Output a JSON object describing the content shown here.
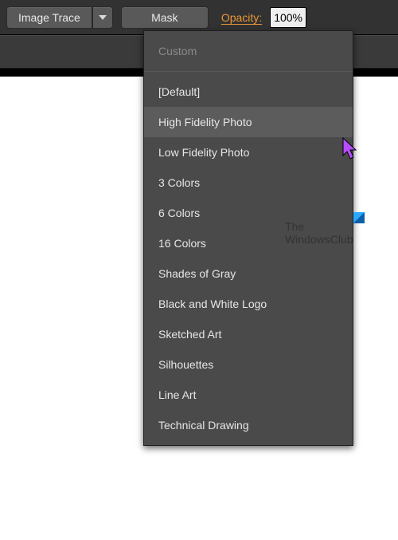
{
  "toolbar": {
    "image_trace_label": "Image Trace",
    "mask_label": "Mask",
    "opacity_label": "Opacity:",
    "opacity_value": "100%"
  },
  "dropdown": {
    "header_disabled": "Custom",
    "items": [
      "[Default]",
      "High Fidelity Photo",
      "Low Fidelity Photo",
      "3 Colors",
      "6 Colors",
      "16 Colors",
      "Shades of Gray",
      "Black and White Logo",
      "Sketched Art",
      "Silhouettes",
      "Line Art",
      "Technical Drawing"
    ],
    "hover_index": 1
  },
  "watermark": {
    "line1": "The",
    "line2": "WindowsClub"
  }
}
